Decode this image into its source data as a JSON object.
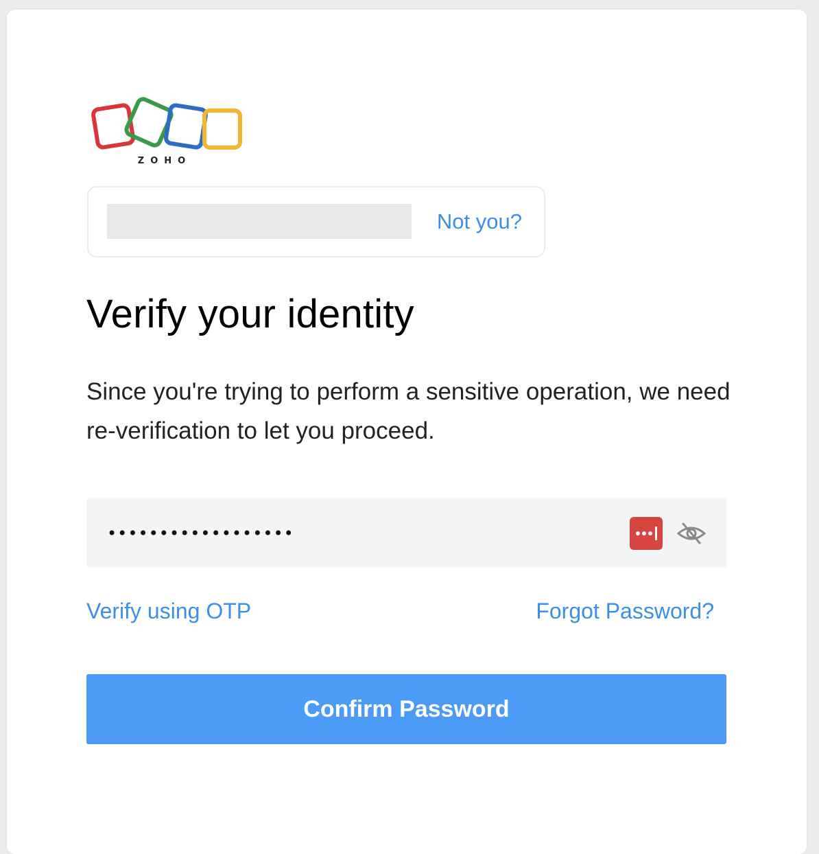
{
  "logo": {
    "text": "ZOHO",
    "colors": [
      "#d8363a",
      "#3b9a48",
      "#2a6ec4",
      "#f2b632"
    ]
  },
  "account": {
    "masked_identity": "",
    "not_you_label": "Not you?"
  },
  "heading": {
    "title": "Verify your identity",
    "description": "Since you're trying to perform a sensitive operation, we need re-verification to let you proceed."
  },
  "password": {
    "value": "••••••••••••••••••",
    "password_manager_icon": "password-manager-icon",
    "visibility_icon": "eye-slash-icon"
  },
  "links": {
    "verify_otp": "Verify using OTP",
    "forgot_password": "Forgot Password?"
  },
  "actions": {
    "confirm_label": "Confirm Password"
  },
  "colors": {
    "accent": "#4a9af6",
    "link": "#3b8fe8",
    "field_bg": "#f3f4f6"
  }
}
